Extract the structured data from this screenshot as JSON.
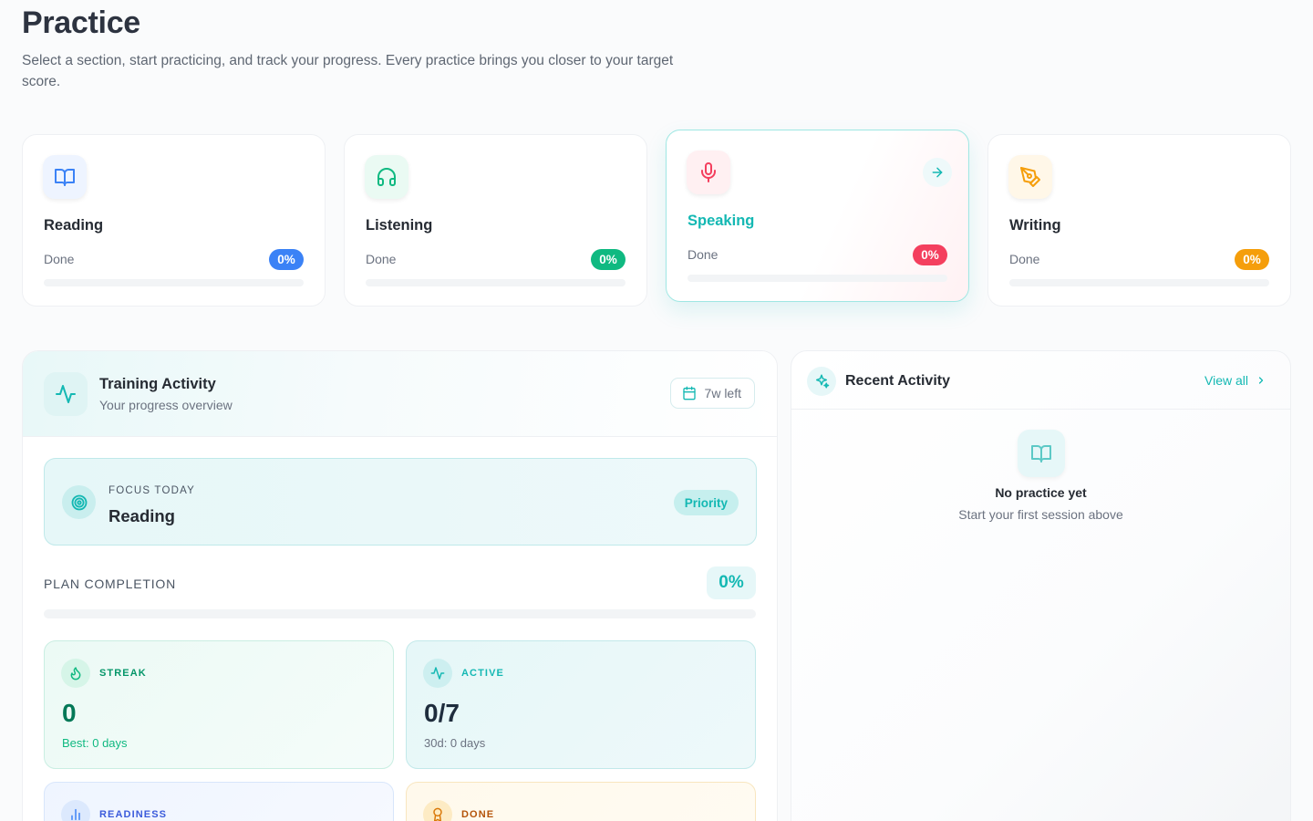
{
  "header": {
    "title": "Practice",
    "subtitle": "Select a section, start practicing, and track your progress. Every practice brings you closer to your target score."
  },
  "skills": [
    {
      "name": "Reading",
      "done_label": "Done",
      "percent_label": "0%",
      "progress": 0,
      "icon": "book-open-icon",
      "color": "#3b82f6"
    },
    {
      "name": "Listening",
      "done_label": "Done",
      "percent_label": "0%",
      "progress": 0,
      "icon": "headphones-icon",
      "color": "#10b981"
    },
    {
      "name": "Speaking",
      "done_label": "Done",
      "percent_label": "0%",
      "progress": 0,
      "icon": "microphone-icon",
      "color": "#f43f5e",
      "selected": true
    },
    {
      "name": "Writing",
      "done_label": "Done",
      "percent_label": "0%",
      "progress": 0,
      "icon": "pen-tool-icon",
      "color": "#f59e0b"
    }
  ],
  "training": {
    "title": "Training Activity",
    "subtitle": "Your progress overview",
    "weeks_left": "7w left",
    "focus_label": "FOCUS TODAY",
    "focus_value": "Reading",
    "priority_label": "Priority",
    "plan_label": "PLAN COMPLETION",
    "plan_percent": "0%",
    "plan_progress": 0,
    "stats": [
      {
        "label": "STREAK",
        "value": "0",
        "note": "Best: 0 days",
        "icon": "flame-icon"
      },
      {
        "label": "ACTIVE",
        "value": "0/7",
        "note": "30d: 0 days",
        "icon": "activity-icon"
      },
      {
        "label": "READINESS",
        "icon": "bar-chart-icon"
      },
      {
        "label": "DONE",
        "icon": "award-icon"
      }
    ]
  },
  "recent": {
    "title": "Recent Activity",
    "view_all": "View all",
    "empty_title": "No practice yet",
    "empty_subtitle": "Start your first session above"
  },
  "colors": {
    "accent": "#14b8b3",
    "reading": "#3b82f6",
    "listening": "#10b981",
    "speaking": "#f43f5e",
    "writing": "#f59e0b"
  }
}
